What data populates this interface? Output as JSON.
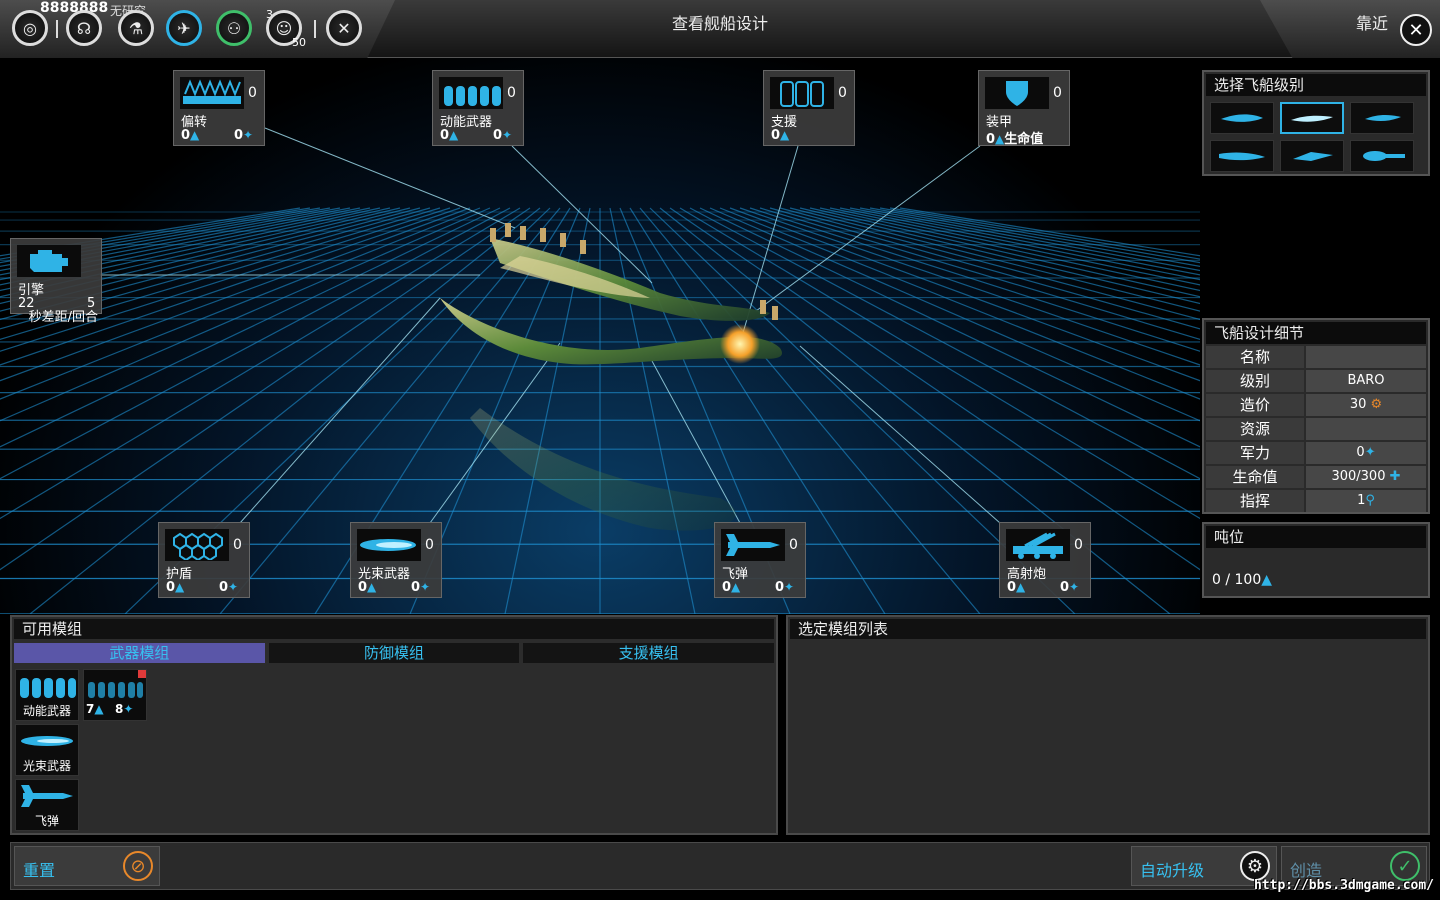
{
  "topbar": {
    "credits": "8888888",
    "research_label": "无研究",
    "influence_small": "3",
    "pop_small": "50",
    "title": "查看舰船设计",
    "zoom_label": "靠近",
    "close_icon": "close-icon"
  },
  "slots": {
    "deflector": {
      "name": "偏转",
      "count": "0",
      "v1": "0",
      "v2": "0"
    },
    "kinetic": {
      "name": "动能武器",
      "count": "0",
      "v1": "0",
      "v2": "0"
    },
    "support": {
      "name": "支援",
      "count": "0",
      "v1": "0"
    },
    "armor": {
      "name": "装甲",
      "count": "0",
      "v1": "0",
      "v1_suffix": "生命值"
    },
    "engine": {
      "name": "引擎",
      "v1": "22",
      "v2": "5",
      "note": "秒差距/回合"
    },
    "shield": {
      "name": "护盾",
      "count": "0",
      "v1": "0",
      "v2": "0"
    },
    "beam": {
      "name": "光束武器",
      "count": "0",
      "v1": "0",
      "v2": "0"
    },
    "missile": {
      "name": "飞弹",
      "count": "0",
      "v1": "0",
      "v2": "0"
    },
    "flak": {
      "name": "高射炮",
      "count": "0",
      "v1": "0",
      "v2": "0"
    }
  },
  "class_panel": {
    "title": "选择飞船级别",
    "selected_index": 1
  },
  "details": {
    "title": "飞船设计细节",
    "rows": [
      {
        "k": "名称",
        "v": ""
      },
      {
        "k": "级别",
        "v": "BARO"
      },
      {
        "k": "造价",
        "v": "30"
      },
      {
        "k": "资源",
        "v": ""
      },
      {
        "k": "军力",
        "v": "0"
      },
      {
        "k": "生命值",
        "v": "300/300"
      },
      {
        "k": "指挥",
        "v": "1"
      }
    ]
  },
  "tonnage": {
    "title": "吨位",
    "text": "0 / 100",
    "fill": 0.0
  },
  "available": {
    "title": "可用模组",
    "tabs": [
      "武器模组",
      "防御模组",
      "支援模组"
    ],
    "active_tab": 0,
    "modules": [
      {
        "label": "动能武器"
      },
      {
        "v1": "7",
        "v2": "8"
      },
      {
        "label": "光束武器"
      },
      {
        "label": "飞弹"
      }
    ]
  },
  "selected": {
    "title": "选定模组列表"
  },
  "footer": {
    "reset": "重置",
    "auto_upgrade": "自动升级",
    "create": "创造"
  },
  "watermark": "http://bbs.3dmgame.com/",
  "colors": {
    "accent": "#37c0f0",
    "tab_active": "#5a56a8",
    "ok_green": "#3fbf6a",
    "reset_orange": "#e8882a"
  }
}
